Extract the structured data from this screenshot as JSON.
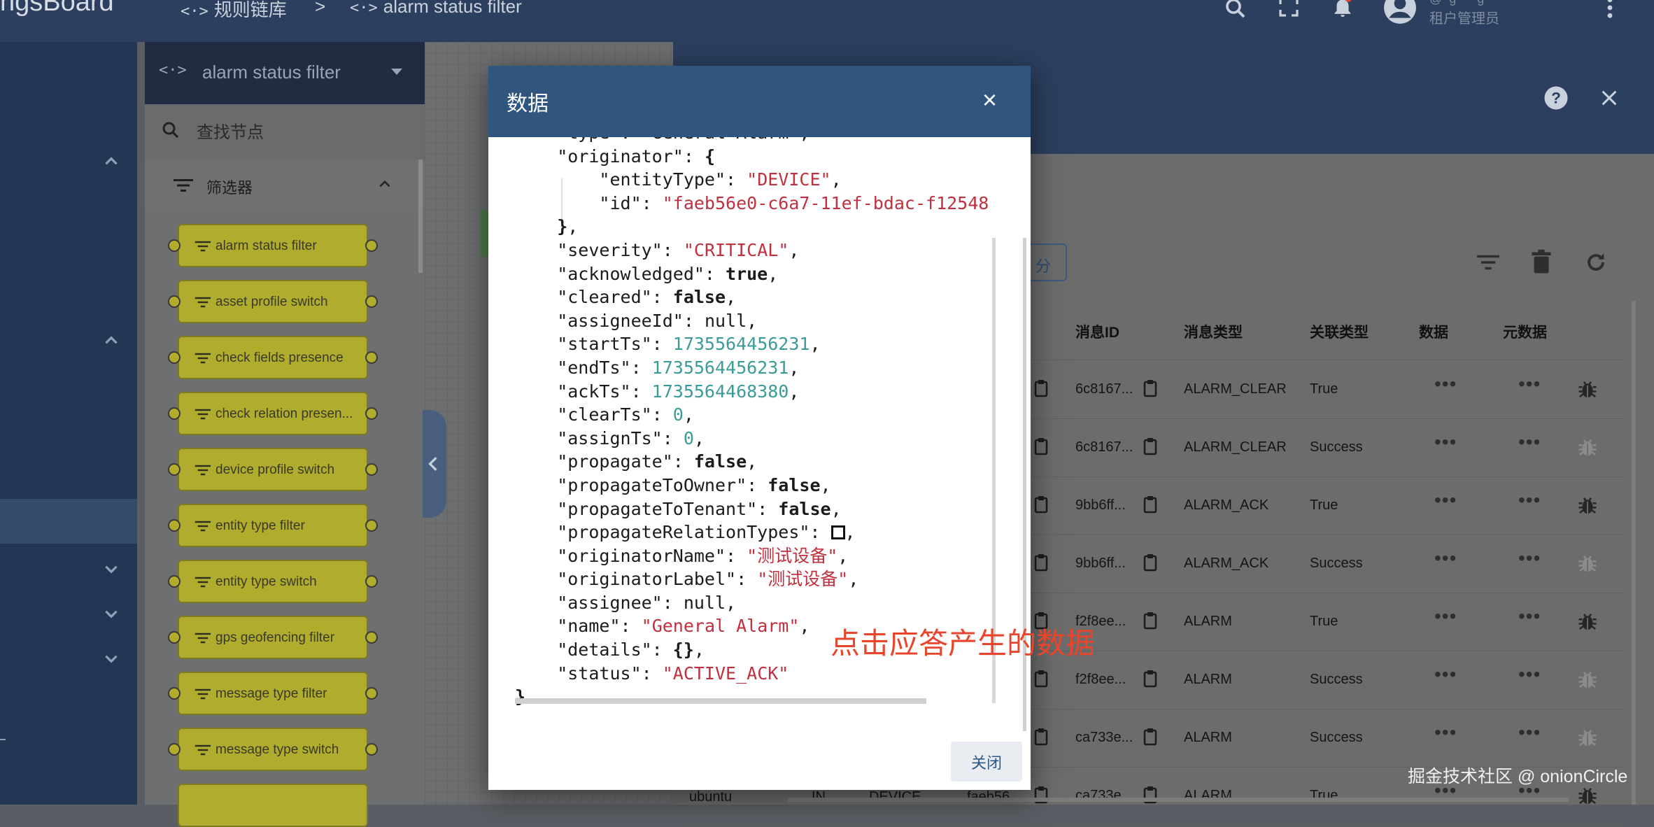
{
  "topbar": {
    "brand": "ngsBoard",
    "crumb1": "规则链库",
    "crumb_sep": ">",
    "crumb2": "alarm status filter",
    "crumb_icon": "<·>",
    "user_role": "租户管理员",
    "user_line": "@  g      g"
  },
  "leftnav": {
    "collapse_icon": "chevron-up-icon",
    "expand_icon": "chevron-down-icon"
  },
  "node_panel": {
    "title": "alarm status filter",
    "title_icon": "<·>",
    "search_placeholder": "查找节点",
    "section": "筛选器",
    "nodes": [
      "alarm status filter",
      "asset profile switch",
      "check fields presence",
      "check relation presen...",
      "device profile switch",
      "entity type filter",
      "entity type switch",
      "gps geofencing filter",
      "message type filter",
      "message type switch"
    ]
  },
  "debug": {
    "partial_button": "分",
    "columns": [
      "消息ID",
      "消息类型",
      "关联类型",
      "数据",
      "元数据"
    ],
    "rows": [
      {
        "id": "6c8167...",
        "type": "ALARM_CLEAR",
        "relation": "True",
        "bug": "dark"
      },
      {
        "id": "6c8167...",
        "type": "ALARM_CLEAR",
        "relation": "Success",
        "bug": "light"
      },
      {
        "id": "9bb6ff...",
        "type": "ALARM_ACK",
        "relation": "True",
        "bug": "dark"
      },
      {
        "id": "9bb6ff...",
        "type": "ALARM_ACK",
        "relation": "Success",
        "bug": "light"
      },
      {
        "id": "f2f8ee...",
        "type": "ALARM",
        "relation": "True",
        "bug": "dark"
      },
      {
        "id": "f2f8ee...",
        "type": "ALARM",
        "relation": "Success",
        "bug": "light"
      },
      {
        "id": "ca733e...",
        "type": "ALARM",
        "relation": "Success",
        "bug": "light"
      },
      {
        "id": "ca733e...",
        "type": "ALARM",
        "relation": "True",
        "bug": "dark"
      }
    ],
    "partial_row": {
      "server": "ubuntu",
      "dir": "IN",
      "entity": "DEVICE",
      "uuid": "faeb56"
    },
    "dots": "•••"
  },
  "dialog": {
    "title": "数据",
    "close_icon": "×",
    "close_button": "关闭",
    "json": {
      "id": "faeb56e0-c6a7-11ef-bdac-f12548",
      "entityType": "DEVICE",
      "severity": "CRITICAL",
      "acknowledged": "true",
      "cleared": "false",
      "assigneeId": "null",
      "startTs": "1735564456231",
      "endTs": "1735564456231",
      "ackTs": "1735564468380",
      "clearTs": "0",
      "assignTs": "0",
      "propagate": "false",
      "propagateToOwner": "false",
      "propagateToTenant": "false",
      "originatorName": "测试设备",
      "originatorLabel": "测试设备",
      "assignee": "null",
      "name": "General Alarm",
      "status": "ACTIVE_ACK"
    }
  },
  "annotation": "点击应答产生的数据",
  "watermark": "掘金技术社区 @ onionCircle",
  "colors": {
    "topbar": "#2c3f5e",
    "dialog_header": "#305680",
    "node_fill": "#b0ac2e",
    "json_string": "#c0303e",
    "json_number": "#3a9b98",
    "annotation": "#e8452c"
  }
}
